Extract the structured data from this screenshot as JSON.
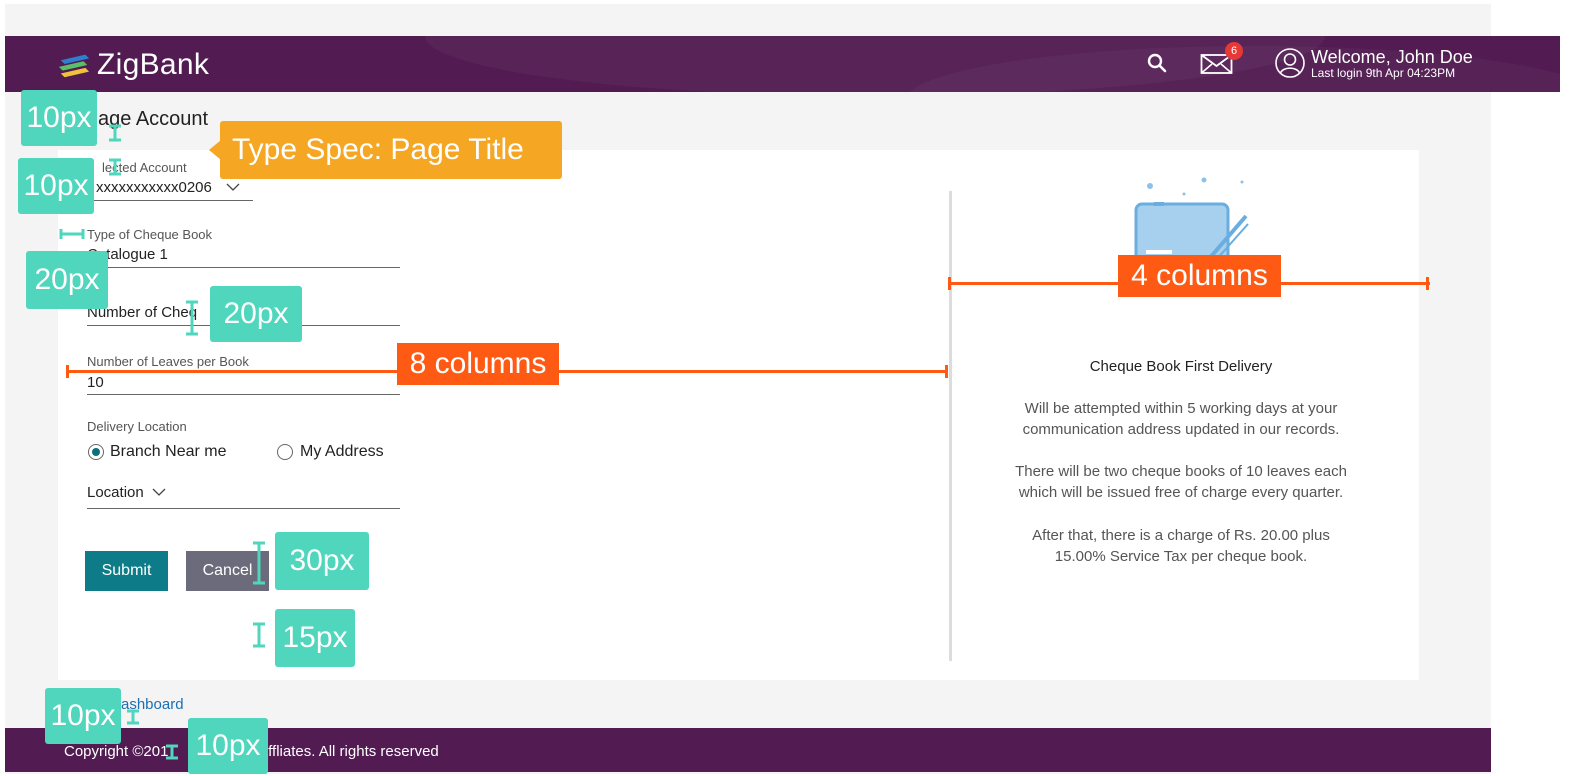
{
  "header": {
    "brand": "ZigBank",
    "mail_count": "6",
    "welcome": "Welcome, John Doe",
    "last_login": "Last login 9th Apr 04:23PM"
  },
  "page": {
    "title": "Manage Account",
    "title_visible": "age Account"
  },
  "form": {
    "selected_account_label": "Selected Account",
    "selected_account_label_visible": "lected Account",
    "selected_account_value": "xxxxxxxxxxx0206",
    "cheque_type_label": "Type of Cheque Book",
    "cheque_type_value": "C  talogue 1",
    "num_cheque_label": "Number of Cheq",
    "leaves_label": "Number of Leaves per Book",
    "leaves_value": "10",
    "delivery_label": "Delivery Location",
    "radio_branch": "Branch Near me",
    "radio_address": "My Address",
    "location_label": "Location",
    "submit": "Submit",
    "cancel": "Cancel"
  },
  "info": {
    "title": "Cheque Book First Delivery",
    "para1_line1": "Will be attempted within 5 working days at your",
    "para1_line2": "communication address updated in our records.",
    "para2_line1": "There will be two cheque books of 10 leaves each",
    "para2_line2": "which will be issued free of charge every quarter.",
    "para3_line1": "After that, there is a charge of Rs. 20.00 plus",
    "para3_line2": "15.00% Service Tax per cheque book."
  },
  "footer": {
    "dashboard_link": "ashboard",
    "copyright": "Copyright ©201",
    "copyright_rest": "r its affliates. All rights reserved"
  },
  "annotations": {
    "a1": "10px",
    "a2": "10px",
    "a3": "20px",
    "a4": "20px",
    "a5": "30px",
    "a6": "15px",
    "a7": "10px",
    "a8": "10px",
    "page_title_spec": "Type Spec: Page Title",
    "eight_cols": "8 columns",
    "four_cols": "4 columns"
  },
  "colors": {
    "brand_purple": "#521c52",
    "primary_teal": "#0d7c88",
    "annotation_teal": "#4fd6bc",
    "annotation_orange": "#ff5a14",
    "annotation_yellow": "#f5a623"
  }
}
